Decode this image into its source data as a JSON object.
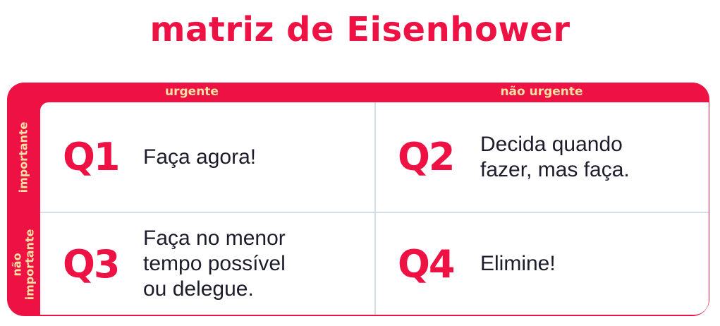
{
  "title": "matriz de Eisenhower",
  "columns": {
    "urgent": "urgente",
    "not_urgent": "não urgente"
  },
  "rows": {
    "important": [
      "importante"
    ],
    "not_important": [
      "não",
      "importante"
    ]
  },
  "quadrants": [
    {
      "id": "Q1",
      "text_lines": [
        "Faça agora!"
      ]
    },
    {
      "id": "Q2",
      "text_lines": [
        "Decida quando",
        "fazer, mas faça."
      ]
    },
    {
      "id": "Q3",
      "text_lines": [
        "Faça no menor",
        "tempo possível",
        "ou delegue."
      ]
    },
    {
      "id": "Q4",
      "text_lines": [
        "Elimine!"
      ]
    }
  ],
  "colors": {
    "accent": "#ee1144",
    "header_text": "#f6e1a4",
    "body_text": "#1c1c2a",
    "grid_line": "#d4dde8"
  }
}
